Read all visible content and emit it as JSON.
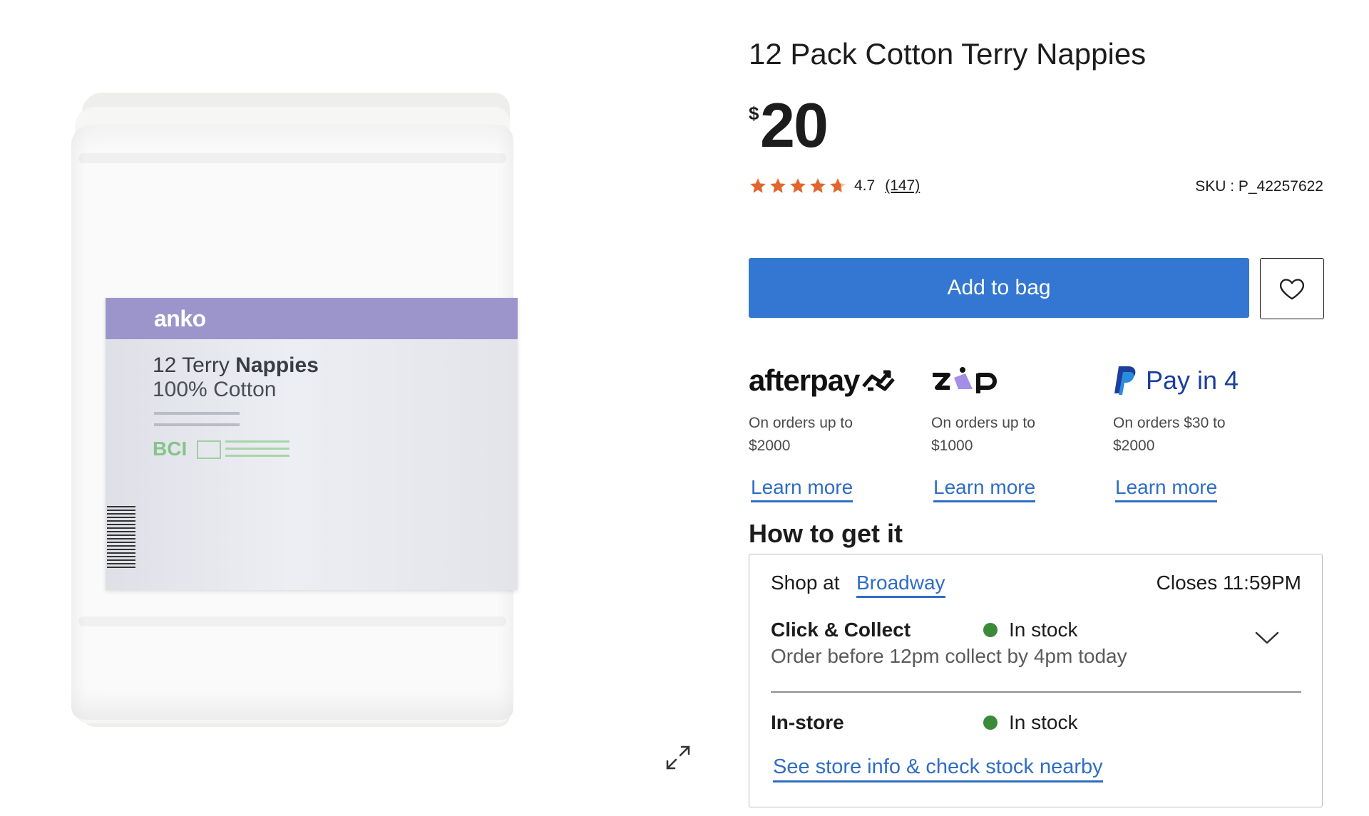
{
  "product": {
    "title": "12 Pack Cotton Terry Nappies",
    "price_currency": "$",
    "price_amount": "20",
    "rating": "4.7",
    "rating_stars": 4.7,
    "review_count": "(147)",
    "sku": "SKU : P_42257622"
  },
  "image": {
    "brand": "anko",
    "title_light": "12 Terry ",
    "title_bold": "Nappies",
    "subtitle": "100% Cotton",
    "bci": "BCI"
  },
  "actions": {
    "add_to_bag": "Add to bag"
  },
  "payment_options": [
    {
      "name": "afterpay",
      "logo_text": "afterpay",
      "description": "On orders up to $2000",
      "link": "Learn more"
    },
    {
      "name": "zip",
      "logo_text": "zip",
      "description": "On orders up to $1000",
      "link": "Learn more"
    },
    {
      "name": "paypal",
      "logo_text": "Pay in 4",
      "description": "On orders $30 to $2000",
      "link": "Learn more"
    }
  ],
  "fulfilment": {
    "heading": "How to get it",
    "shop_at_label": "Shop at",
    "store_name": "Broadway",
    "closes": "Closes 11:59PM",
    "click_collect_label": "Click & Collect",
    "click_collect_status": "In stock",
    "click_collect_note": "Order before 12pm collect by 4pm today",
    "instore_label": "In-store",
    "instore_status": "In stock",
    "nearby_link": "See store info & check stock nearby"
  },
  "colors": {
    "primary_button": "#3377d2",
    "link": "#2f6dc4",
    "star": "#e0662e",
    "in_stock": "#3a8a3a",
    "label_band": "#9b95cc"
  }
}
